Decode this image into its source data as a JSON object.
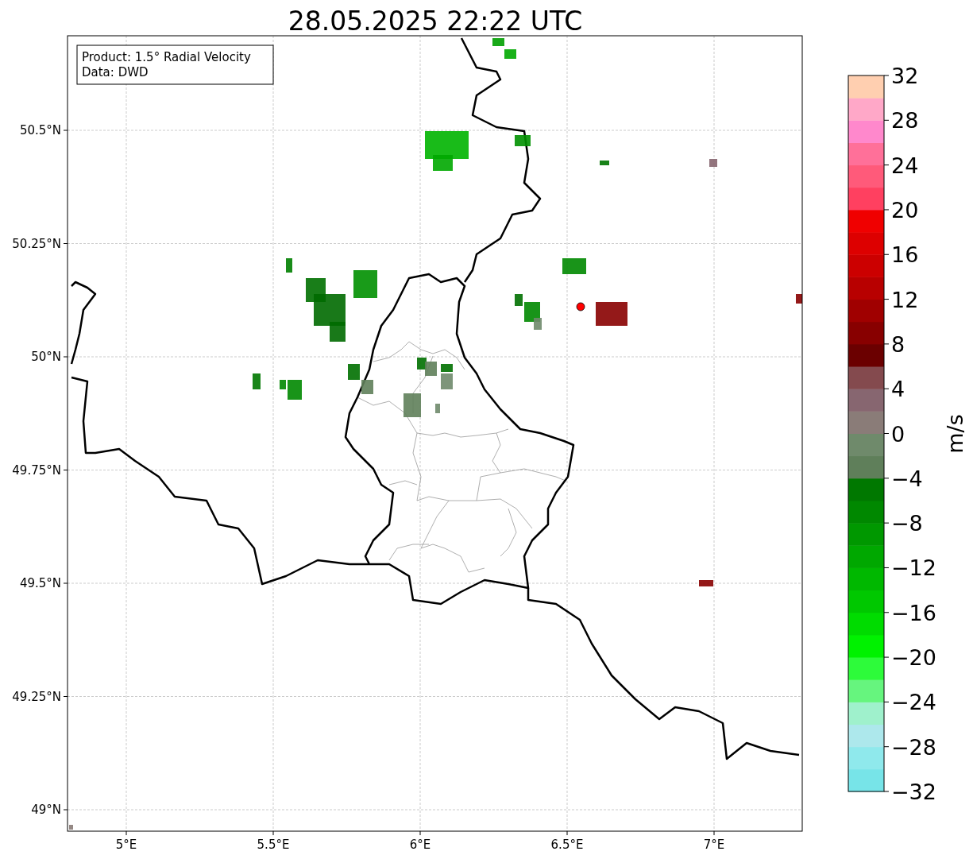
{
  "title": "28.05.2025 22:22 UTC",
  "info_box": [
    "Product: 1.5° Radial Velocity",
    "Data: DWD"
  ],
  "x_ticks": [
    "5°E",
    "5.5°E",
    "6°E",
    "6.5°E",
    "7°E"
  ],
  "y_ticks": [
    "50.5°N",
    "50.25°N",
    "50°N",
    "49.75°N",
    "49.5°N",
    "49.25°N",
    "49°N"
  ],
  "colorbar": {
    "label": "m/s",
    "ticks": [
      "32",
      "28",
      "24",
      "20",
      "16",
      "12",
      "8",
      "4",
      "0",
      "−4",
      "−8",
      "−12",
      "−16",
      "−20",
      "−24",
      "−28",
      "−32"
    ]
  }
}
